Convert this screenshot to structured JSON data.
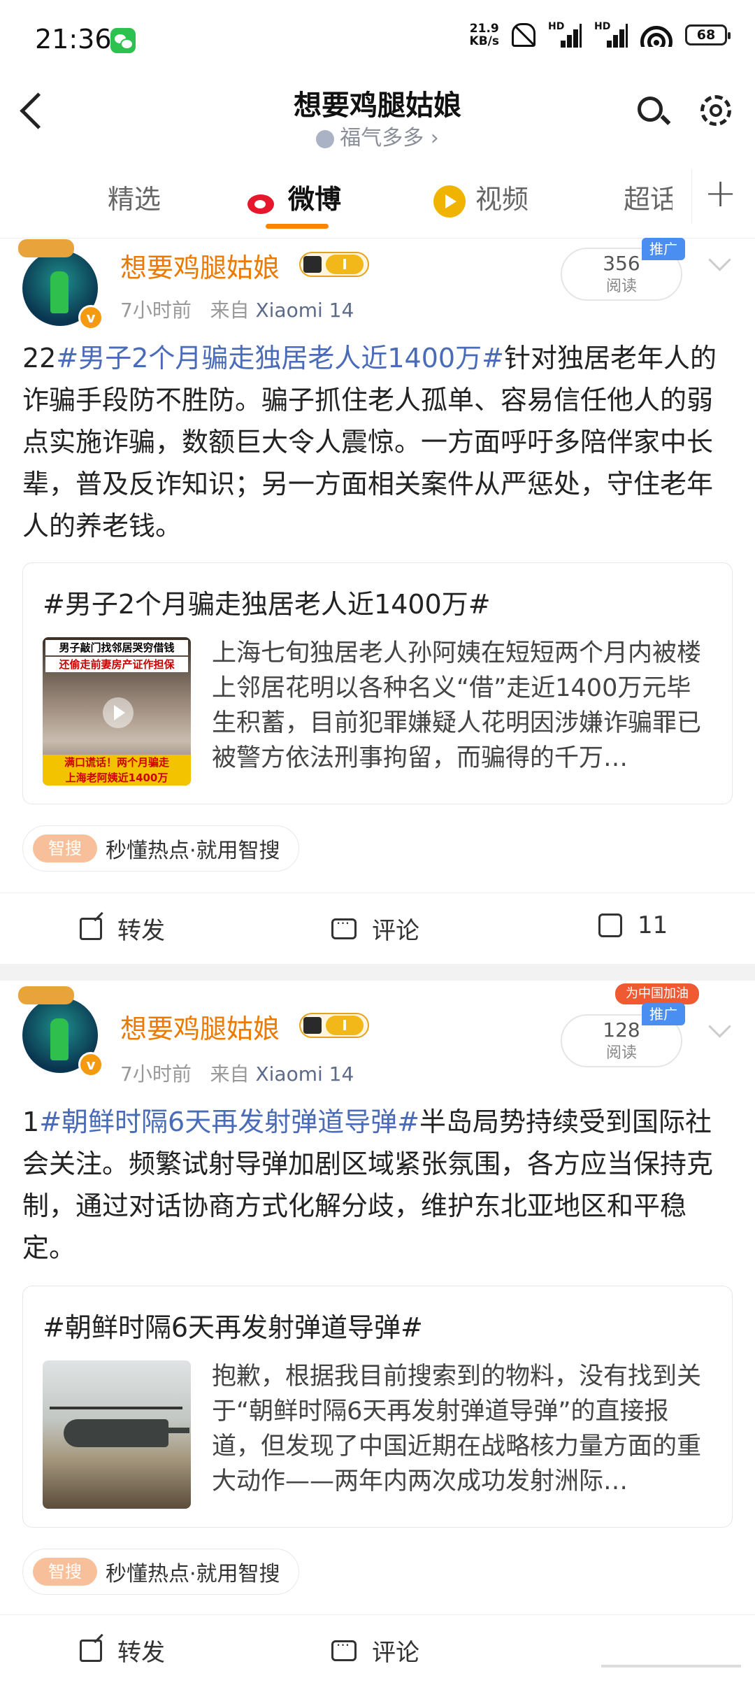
{
  "status": {
    "time": "21:36",
    "net_speed": "21.9\nKB/s",
    "net_speed_top": "21.9",
    "net_speed_bottom": "KB/s",
    "battery": "68",
    "hd1": "HD",
    "hd2": "HD"
  },
  "header": {
    "title": "想要鸡腿姑娘",
    "subtitle": "福气多多 ›"
  },
  "tabs": [
    {
      "label": "精选"
    },
    {
      "label": "微博"
    },
    {
      "label": "视频"
    },
    {
      "label": "超话"
    }
  ],
  "accent": "#ff8200",
  "posts": [
    {
      "username": "想要鸡腿姑娘",
      "level": "I",
      "time": "7小时前",
      "from": "来自",
      "device": "Xiaomi 14",
      "reads": "356",
      "reads_label": "阅读",
      "promo": "推广",
      "text_prefix": "22",
      "hashtag": "#男子2个月骗走独居老人近1400万#",
      "text": "针对独居老年人的诈骗手段防不胜防。骗子抓住老人孤单、容易信任他人的弱点实施诈骗，数额巨大令人震惊。一方面呼吁多陪伴家中长辈，普及反诈知识；另一方面相关案件从严惩处，守住老年人的养老钱。",
      "card_title": "#男子2个月骗走独居老人近1400万#",
      "card_text": "上海七旬独居老人孙阿姨在短短两个月内被楼上邻居花明以各种名义“借”走近1400万元毕生积蓄，目前犯罪嫌疑人花明因涉嫌诈骗罪已被警方依法刑事拘留，而骗得的千万…",
      "thumb_top1": "男子敲门找邻居哭穷借钱",
      "thumb_top2": "还偷走前妻房产证作担保",
      "thumb_bottom1": "满口谎话！两个月骗走",
      "thumb_bottom2": "上海老阿姨近1400万",
      "zhisou_badge": "智搜",
      "zhisou": "秒懂热点·就用智搜",
      "repost": "转发",
      "comment": "评论",
      "likes": "11"
    },
    {
      "username": "想要鸡腿姑娘",
      "level": "I",
      "time": "7小时前",
      "from": "来自",
      "device": "Xiaomi 14",
      "reads": "128",
      "reads_label": "阅读",
      "promo": "推广",
      "promo_top": "为中国加油",
      "text_prefix": "1",
      "hashtag": "#朝鲜时隔6天再发射弹道导弹#",
      "text": "半岛局势持续受到国际社会关注。频繁试射导弹加剧区域紧张氛围，各方应当保持克制，通过对话协商方式化解分歧，维护东北亚地区和平稳定。",
      "card_title": "#朝鲜时隔6天再发射弹道导弹#",
      "card_text": "抱歉，根据我目前搜索到的物料，没有找到关于“朝鲜时隔6天再发射弹道导弹”的直接报道，但发现了中国近期在战略核力量方面的重大动作——两年内两次成功发射洲际…",
      "zhisou_badge": "智搜",
      "zhisou": "秒懂热点·就用智搜",
      "repost": "转发",
      "comment": "评论"
    }
  ]
}
